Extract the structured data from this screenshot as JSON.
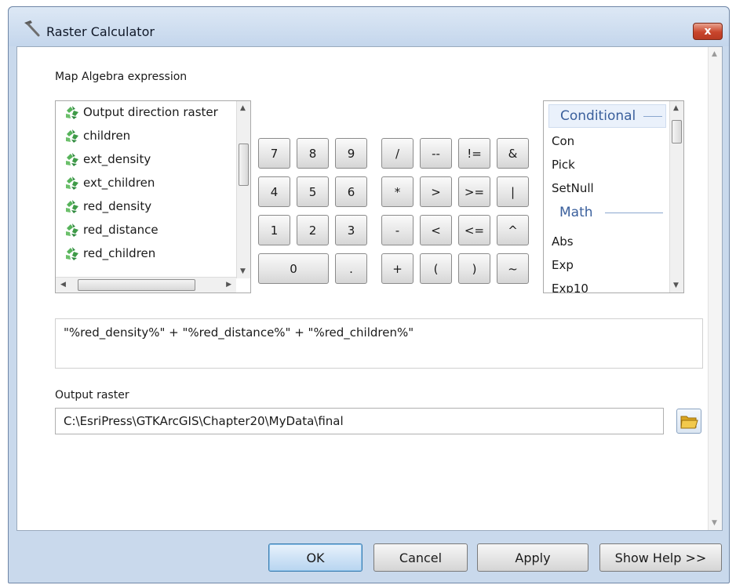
{
  "window": {
    "title": "Raster Calculator",
    "close_label": "x"
  },
  "expression_section": {
    "label": "Map Algebra expression"
  },
  "layers": [
    {
      "name": "Output direction raster"
    },
    {
      "name": "children"
    },
    {
      "name": "ext_density"
    },
    {
      "name": "ext_children"
    },
    {
      "name": "red_density"
    },
    {
      "name": "red_distance"
    },
    {
      "name": "red_children"
    }
  ],
  "keypad": {
    "rows": [
      [
        "7",
        "8",
        "9",
        "/",
        "--",
        "!=",
        "&"
      ],
      [
        "4",
        "5",
        "6",
        "*",
        ">",
        ">=",
        "|"
      ],
      [
        "1",
        "2",
        "3",
        "-",
        "<",
        "<=",
        "^"
      ],
      [
        "0",
        ".",
        "+",
        "(",
        ")",
        "~"
      ]
    ]
  },
  "functions": {
    "groups": [
      {
        "name": "Conditional",
        "items": [
          "Con",
          "Pick",
          "SetNull"
        ]
      },
      {
        "name": "Math",
        "items": [
          "Abs",
          "Exp",
          "Exp10"
        ]
      }
    ]
  },
  "expression": "\"%red_density%\" + \"%red_distance%\" + \"%red_children%\"",
  "output": {
    "label": "Output raster",
    "value": "C:\\EsriPress\\GTKArcGIS\\Chapter20\\MyData\\final"
  },
  "buttons": {
    "ok": "OK",
    "cancel": "Cancel",
    "apply": "Apply",
    "help": "Show Help >>"
  },
  "colors": {
    "accent": "#3a5f9c",
    "close": "#c9462c",
    "window_frame": "#c9d9ec"
  }
}
